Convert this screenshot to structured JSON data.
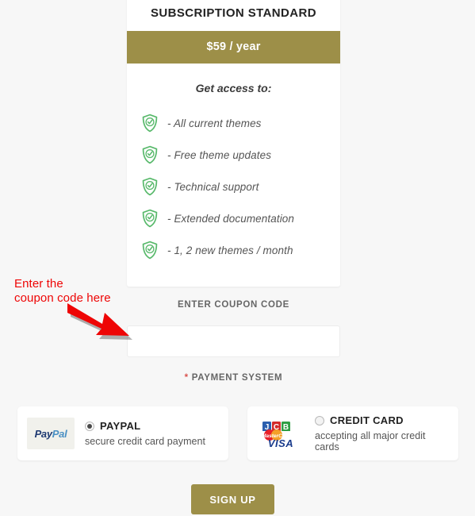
{
  "plan": {
    "title": "SUBSCRIPTION STANDARD",
    "price": "$59 / year",
    "access_label": "Get access to:",
    "features": [
      {
        "icon": "shield-check-icon",
        "text": "- All current themes"
      },
      {
        "icon": "shield-check-icon",
        "text": "- Free theme updates"
      },
      {
        "icon": "shield-check-icon",
        "text": "- Technical support"
      },
      {
        "icon": "shield-check-icon",
        "text": "- Extended documentation"
      },
      {
        "icon": "shield-check-icon",
        "text": "- 1, 2 new themes / month"
      }
    ]
  },
  "coupon": {
    "label": "ENTER COUPON CODE",
    "value": "",
    "placeholder": ""
  },
  "annotation": {
    "text": "Enter the\ncoupon code here",
    "color": "#ee0505",
    "arrow_icon": "red-arrow-icon"
  },
  "payment": {
    "label": "PAYMENT SYSTEM",
    "required_marker": "*",
    "options": [
      {
        "id": "paypal",
        "logo": "paypal-logo",
        "logo_text_1": "Pay",
        "logo_text_2": "Pal",
        "title": "PAYPAL",
        "subtitle": "secure credit card payment",
        "selected": true
      },
      {
        "id": "credit-card",
        "logo": "credit-cards-logo",
        "logo_text_1": "JCB",
        "logo_text_2": "MasterCard",
        "logo_text_3": "VISA",
        "title": "CREDIT CARD",
        "subtitle": "accepting all major credit cards",
        "selected": false
      }
    ]
  },
  "signup": {
    "label": "SIGN UP"
  },
  "colors": {
    "gold": "#9d8f48",
    "page_background": "#f7f7f7",
    "shield_green": "#58b96b",
    "annotation_red": "#ee0505",
    "required_red": "#d9534f"
  }
}
